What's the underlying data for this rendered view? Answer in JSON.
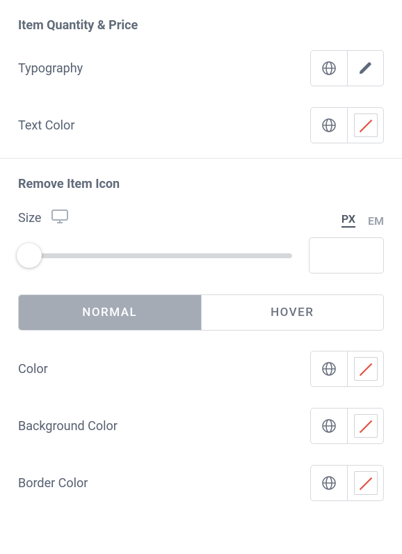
{
  "section1": {
    "title": "Item Quantity & Price",
    "typography_label": "Typography",
    "text_color_label": "Text Color"
  },
  "section2": {
    "title": "Remove Item Icon",
    "size_label": "Size",
    "units": {
      "px": "PX",
      "em": "EM",
      "active": "px"
    },
    "size_value": "",
    "tabs": {
      "normal": "NORMAL",
      "hover": "HOVER",
      "active": "normal"
    },
    "color_label": "Color",
    "bgcolor_label": "Background Color",
    "bordercolor_label": "Border Color"
  }
}
